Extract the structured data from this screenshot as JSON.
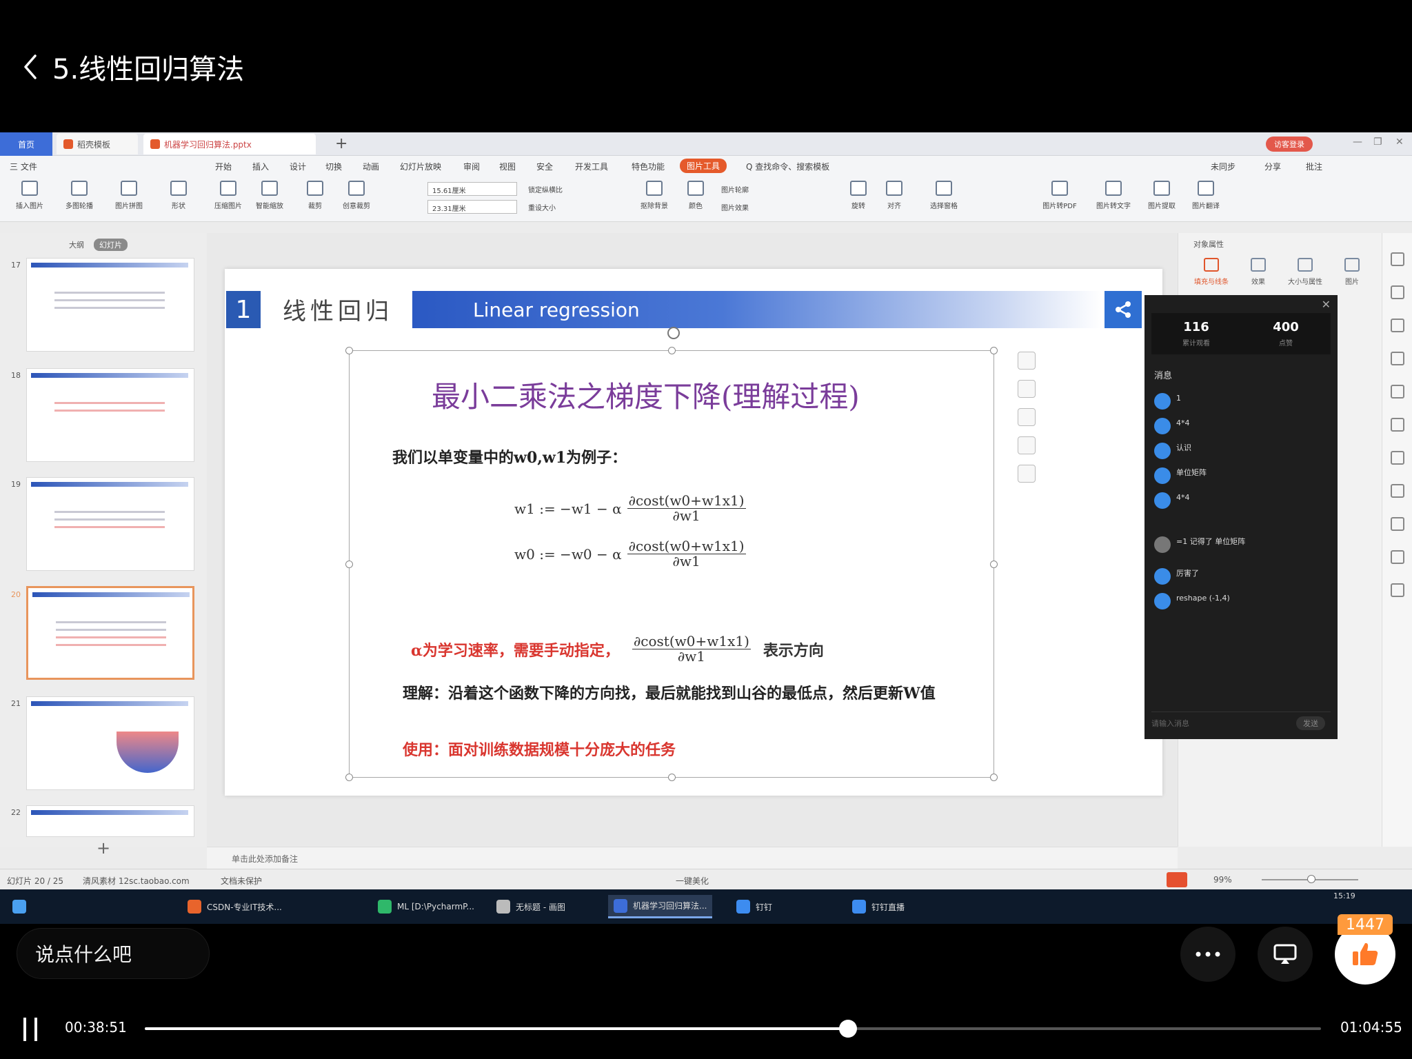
{
  "header": {
    "title": "5.线性回归算法"
  },
  "wps": {
    "tabs": [
      "首页",
      "稻壳模板",
      "机器学习回归算法.pptx"
    ],
    "login_label": "访客登录",
    "menus": [
      "三 文件",
      "开始",
      "插入",
      "设计",
      "切换",
      "动画",
      "幻灯片放映",
      "审阅",
      "视图",
      "安全",
      "开发工具",
      "特色功能",
      "图片工具",
      "Q 查找命令、搜索模板",
      "未同步",
      "分享",
      "批注"
    ],
    "ribbon": [
      "插入图片",
      "多图轮播",
      "图片拼图",
      "形状",
      "压缩图片",
      "智能缩放",
      "裁剪",
      "创意裁剪",
      "抠除背景",
      "颜色",
      "图片轮廓",
      "图片效果",
      "旋转",
      "对齐",
      "选择窗格",
      "图片转PDF",
      "图片转文字",
      "图片提取",
      "图片翻译"
    ],
    "height_value": "15.61厘米",
    "width_value": "23.31厘米",
    "lock_ratio": "锁定纵横比",
    "reset_size": "重设大小",
    "left_tabs": [
      "大纲",
      "幻灯片"
    ],
    "notes_placeholder": "单击此处添加备注",
    "status_slide": "幻灯片 20 / 25",
    "status_theme": "清风素材 12sc.taobao.com",
    "status_protect": "文档未保护",
    "status_beautify": "一键美化",
    "zoom": "99%",
    "props_title": "对象属性",
    "props_tabs": [
      "填充与线条",
      "效果",
      "大小与属性",
      "图片"
    ]
  },
  "thumbnails": [
    {
      "num": "17"
    },
    {
      "num": "18"
    },
    {
      "num": "19"
    },
    {
      "num": "20"
    },
    {
      "num": "21"
    },
    {
      "num": "22"
    }
  ],
  "slide": {
    "number": "1",
    "title": "线性回归",
    "band": "Linear regression",
    "heading": "最小二乘法之梯度下降(理解过程)",
    "intro": "我们以单变量中的w0,w1为例子：",
    "f1_left": "w1 := −w1 − α",
    "f2_left": "w0 := −w0 − α",
    "f_num": "∂cost(w0+w1x1)",
    "f1_den": "∂w1",
    "f2_den": "∂w1",
    "alpha_text": "α为学习速率，需要手动指定，",
    "alpha_num": "∂cost(w0+w1x1)",
    "alpha_den": "∂w1",
    "alpha_tail": "表示方向",
    "understand": "理解：沿着这个函数下降的方向找，最后就能找到山谷的最低点，然后更新W值",
    "usage": "使用：面对训练数据规模十分庞大的任务"
  },
  "chat": {
    "views": "116",
    "views_label": "累计观看",
    "likes": "400",
    "likes_label": "点赞",
    "messages_title": "消息",
    "messages": [
      {
        "text": "1"
      },
      {
        "text": "4*4"
      },
      {
        "text": "认识"
      },
      {
        "text": "单位矩阵"
      },
      {
        "text": "4*4"
      },
      {
        "text": "reshape (-1,4)"
      },
      {
        "text": "厉害了"
      },
      {
        "text": "=1 记得了 单位矩阵"
      }
    ],
    "input_placeholder": "请输入消息",
    "send_label": "发送"
  },
  "taskbar": {
    "items": [
      "CSDN-专业IT技术...",
      "ML [D:\\PycharmP...",
      "无标题 - 画图",
      "机器学习回归算法...",
      "钉钉",
      "钉钉直播"
    ],
    "time": "15:19"
  },
  "player": {
    "comment_placeholder": "说点什么吧",
    "like_count": "1447",
    "current_time": "00:38:51",
    "total_time": "01:04:55",
    "progress": 0.598
  }
}
